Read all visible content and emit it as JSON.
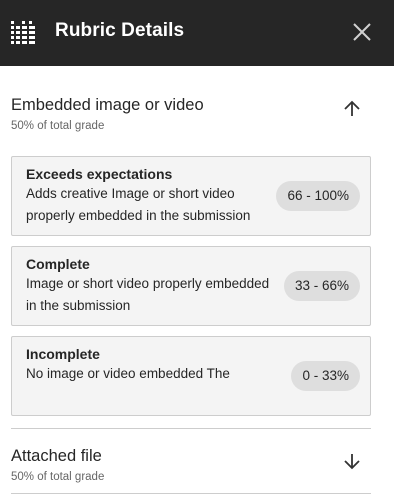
{
  "panel": {
    "title": "Rubric Details",
    "icon": "rubric-grid-icon",
    "close_icon": "close-icon"
  },
  "sections": [
    {
      "title": "Embedded image or video",
      "subtitle": "50% of total grade",
      "expanded": true,
      "toggle_icon": "arrow-up-icon",
      "criteria": [
        {
          "title": "Exceeds expectations",
          "description": "Adds creative Image or short video properly embedded in the submission",
          "range": "66 - 100%"
        },
        {
          "title": "Complete",
          "description": "Image or short video properly embedded in the submission",
          "range": "33 - 66%"
        },
        {
          "title": "Incomplete",
          "description": "No image or video embedded The",
          "range": "0 - 33%"
        }
      ]
    },
    {
      "title": "Attached file",
      "subtitle": "50% of total grade",
      "expanded": false,
      "toggle_icon": "arrow-down-icon"
    }
  ],
  "colors": {
    "header_bg": "#262626",
    "card_bg": "#f4f4f4",
    "badge_bg": "#dedede",
    "border": "#cdcdcd"
  }
}
